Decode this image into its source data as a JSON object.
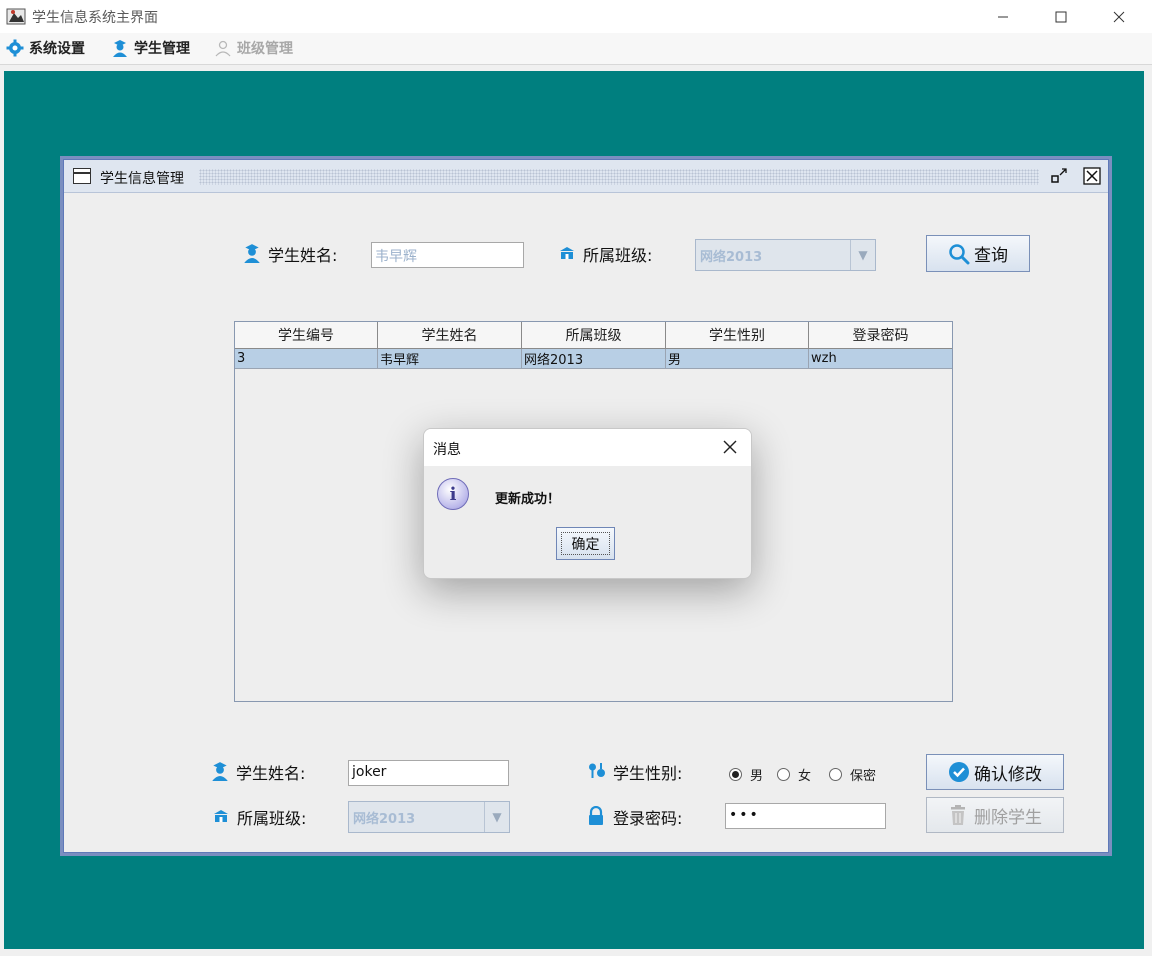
{
  "window": {
    "title": "学生信息系统主界面",
    "minimize_icon": "minimize-icon",
    "maximize_icon": "maximize-icon",
    "close_icon": "close-icon"
  },
  "menubar": {
    "items": [
      {
        "label": "系统设置",
        "icon": "gear-icon",
        "enabled": true
      },
      {
        "label": "学生管理",
        "icon": "student-icon",
        "enabled": true
      },
      {
        "label": "班级管理",
        "icon": "users-icon",
        "enabled": false
      }
    ]
  },
  "colors": {
    "desktop": "#007f7f",
    "accent": "#1e8fd6"
  },
  "internal_frame": {
    "title": "学生信息管理",
    "search": {
      "name_label": "学生姓名:",
      "name_value": "韦早辉",
      "class_label": "所属班级:",
      "class_value": "网络2013",
      "search_button": "查询"
    },
    "table": {
      "columns": [
        "学生编号",
        "学生姓名",
        "所属班级",
        "学生性别",
        "登录密码"
      ],
      "rows": [
        [
          "3",
          "韦早辉",
          "网络2013",
          "男",
          "wzh"
        ]
      ]
    },
    "edit": {
      "name_label": "学生姓名:",
      "name_value": "joker",
      "class_label": "所属班级:",
      "class_value": "网络2013",
      "gender_label": "学生性别:",
      "gender_options": [
        "男",
        "女",
        "保密"
      ],
      "gender_selected": "男",
      "password_label": "登录密码:",
      "password_value": "•••",
      "confirm_button": "确认修改",
      "delete_button": "删除学生"
    }
  },
  "dialog": {
    "title": "消息",
    "message": "更新成功！",
    "ok_button": "确定",
    "icon": "info-icon"
  }
}
